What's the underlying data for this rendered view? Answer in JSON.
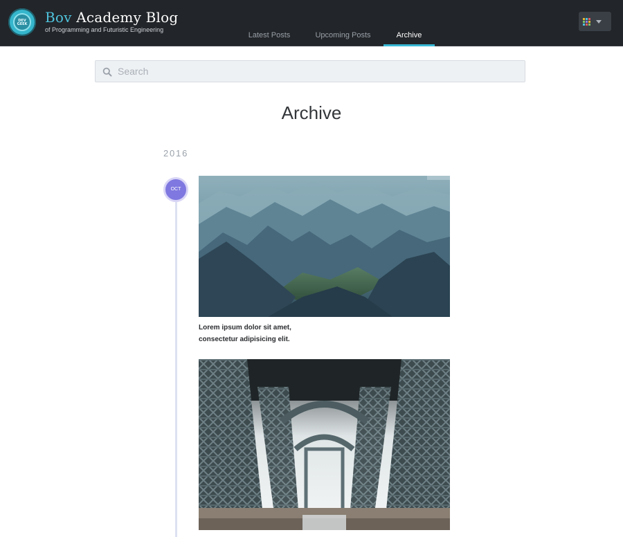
{
  "header": {
    "brand_first": "Bov",
    "brand_rest": " Academy Blog",
    "tagline": "of Programming and Futuristic Engineering",
    "logo_text": "DEV GEEK",
    "nav": [
      {
        "label": "Latest Posts",
        "active": false
      },
      {
        "label": "Upcoming Posts",
        "active": false
      },
      {
        "label": "Archive",
        "active": true
      }
    ],
    "apps_menu_icon": "apps-grid-icon"
  },
  "search": {
    "placeholder": "Search",
    "value": ""
  },
  "page": {
    "title": "Archive"
  },
  "archive": {
    "year": "2016",
    "month": "OCT",
    "posts": [
      {
        "image": "mountain-valley-photo",
        "line1": "Lorem ipsum dolor sit amet,",
        "line2": "consectetur adipisicing elit."
      },
      {
        "image": "steel-bridge-underside-photo"
      }
    ]
  },
  "colors": {
    "header_bg": "#222529",
    "accent": "#37b8d4",
    "month_badge": "#7f78e0",
    "timeline": "#dde2f2"
  }
}
